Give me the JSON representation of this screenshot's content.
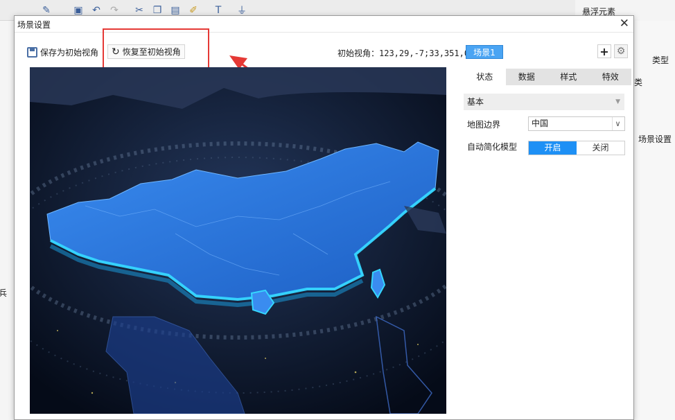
{
  "background": {
    "top_right_label": "悬浮元素",
    "right_labels": [
      "类型",
      "类",
      "场景设置"
    ],
    "left_label": "兵"
  },
  "dialog": {
    "title": "场景设置",
    "close_glyph": "✕"
  },
  "toolbar": {
    "save_label": "保存为初始视角",
    "restore_label": "恢复至初始视角",
    "restore_glyph": "↻",
    "init_view_text": "初始视角：123,29,-7;33,351,0",
    "scene_tab": "场景1",
    "add_glyph": "+",
    "gear_glyph": "⚙"
  },
  "panel": {
    "tabs": [
      "状态",
      "数据",
      "样式",
      "特效"
    ],
    "section": "基本",
    "map_border_label": "地图边界",
    "map_border_value": "中国",
    "simplify_label": "自动简化模型",
    "simplify_on": "开启",
    "simplify_off": "关闭"
  },
  "colors": {
    "accent": "#1e90f5",
    "scene_tab": "#4aa4f3",
    "highlight_box": "#e53935",
    "map_land": "#2b7de8",
    "map_glow": "#35d6ff",
    "map_bg": "#0a1428"
  }
}
